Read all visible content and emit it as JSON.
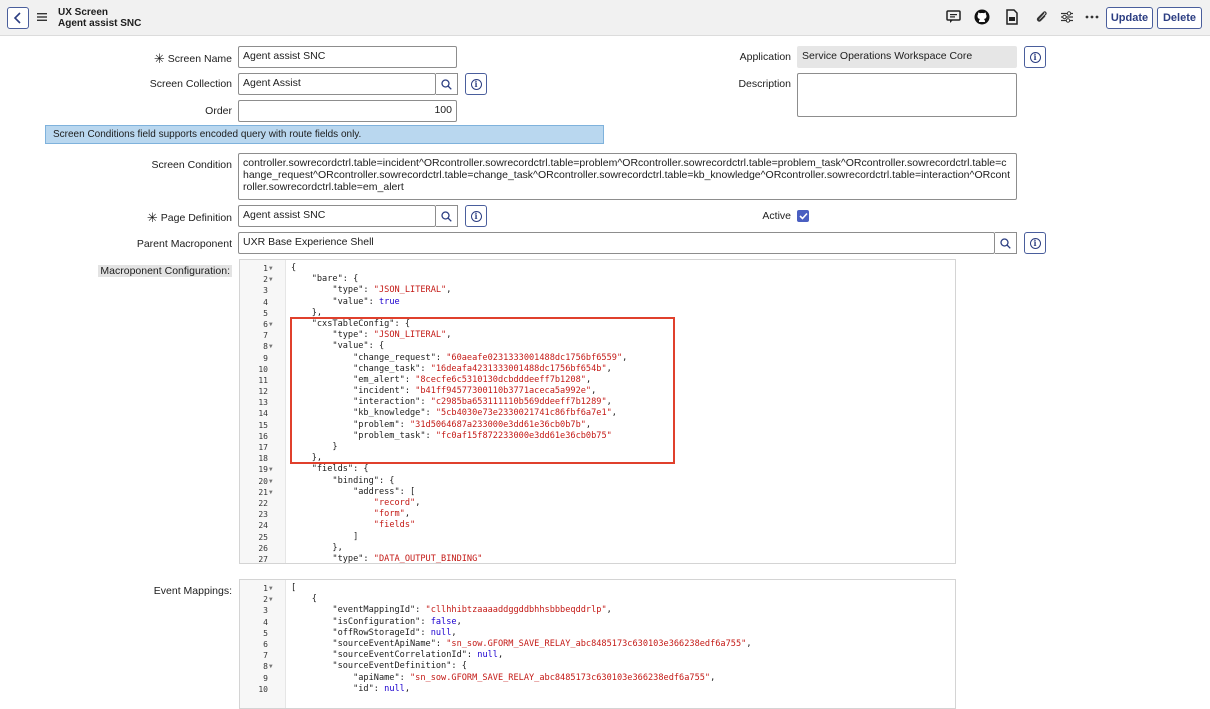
{
  "header": {
    "line1": "UX Screen",
    "line2": "Agent assist SNC",
    "icons": [
      "comment-icon",
      "github-icon",
      "document-icon",
      "attachment-icon",
      "settings-sliders-icon",
      "more-icon"
    ],
    "update_label": "Update",
    "delete_label": "Delete"
  },
  "form": {
    "screen_name_label": "Screen Name",
    "screen_name_value": "Agent assist SNC",
    "screen_collection_label": "Screen Collection",
    "screen_collection_value": "Agent Assist",
    "order_label": "Order",
    "order_value": "100",
    "application_label": "Application",
    "application_value": "Service Operations Workspace Core",
    "description_label": "Description",
    "description_value": "",
    "notice": "Screen Conditions field supports encoded query with route fields only.",
    "screen_condition_label": "Screen Condition",
    "screen_condition_value": "controller.sowrecordctrl.table=incident^ORcontroller.sowrecordctrl.table=problem^ORcontroller.sowrecordctrl.table=problem_task^ORcontroller.sowrecordctrl.table=change_request^ORcontroller.sowrecordctrl.table=change_task^ORcontroller.sowrecordctrl.table=kb_knowledge^ORcontroller.sowrecordctrl.table=interaction^ORcontroller.sowrecordctrl.table=em_alert",
    "page_definition_label": "Page Definition",
    "page_definition_value": "Agent assist SNC",
    "active_label": "Active",
    "active_checked": true,
    "parent_macroponent_label": "Parent Macroponent",
    "parent_macroponent_value": "UXR Base Experience Shell",
    "macroponent_config_label": "Macroponent Configuration:",
    "event_mappings_label": "Event Mappings:"
  },
  "macroponent_config": [
    {
      "n": "1",
      "f": true,
      "t": "{"
    },
    {
      "n": "2",
      "f": true,
      "t": "    \"bare\": {"
    },
    {
      "n": "3",
      "f": false,
      "t": "        \"type\": ",
      "s": "\"JSON_LITERAL\"",
      "e": ","
    },
    {
      "n": "4",
      "f": false,
      "t": "        \"value\": ",
      "k": "true"
    },
    {
      "n": "5",
      "f": false,
      "t": "    },"
    },
    {
      "n": "6",
      "f": true,
      "t": "    \"cxsTableConfig\": {"
    },
    {
      "n": "7",
      "f": false,
      "t": "        \"type\": ",
      "s": "\"JSON_LITERAL\"",
      "e": ","
    },
    {
      "n": "8",
      "f": true,
      "t": "        \"value\": {"
    },
    {
      "n": "9",
      "f": false,
      "t": "            \"change_request\": ",
      "s": "\"60aeafe0231333001488dc1756bf6559\"",
      "e": ","
    },
    {
      "n": "10",
      "f": false,
      "t": "            \"change_task\": ",
      "s": "\"16deafa4231333001488dc1756bf654b\"",
      "e": ","
    },
    {
      "n": "11",
      "f": false,
      "t": "            \"em_alert\": ",
      "s": "\"8cecfe6c5310130dcbdddeeff7b1208\"",
      "e": ","
    },
    {
      "n": "12",
      "f": false,
      "t": "            \"incident\": ",
      "s": "\"b41ff94577300110b3771aceca5a992e\"",
      "e": ","
    },
    {
      "n": "13",
      "f": false,
      "t": "            \"interaction\": ",
      "s": "\"c2985ba653111110b569ddeeff7b1289\"",
      "e": ","
    },
    {
      "n": "14",
      "f": false,
      "t": "            \"kb_knowledge\": ",
      "s": "\"5cb4030e73e2330021741c86fbf6a7e1\"",
      "e": ","
    },
    {
      "n": "15",
      "f": false,
      "t": "            \"problem\": ",
      "s": "\"31d5064687a233000e3dd61e36cb0b7b\"",
      "e": ","
    },
    {
      "n": "16",
      "f": false,
      "t": "            \"problem_task\": ",
      "s": "\"fc0af15f872233000e3dd61e36cb0b75\""
    },
    {
      "n": "17",
      "f": false,
      "t": "        }"
    },
    {
      "n": "18",
      "f": false,
      "t": "    },"
    },
    {
      "n": "19",
      "f": true,
      "t": "    \"fields\": {"
    },
    {
      "n": "20",
      "f": true,
      "t": "        \"binding\": {"
    },
    {
      "n": "21",
      "f": true,
      "t": "            \"address\": ["
    },
    {
      "n": "22",
      "f": false,
      "t": "                ",
      "s": "\"record\"",
      "e": ","
    },
    {
      "n": "23",
      "f": false,
      "t": "                ",
      "s": "\"form\"",
      "e": ","
    },
    {
      "n": "24",
      "f": false,
      "t": "                ",
      "s": "\"fields\""
    },
    {
      "n": "25",
      "f": false,
      "t": "            ]"
    },
    {
      "n": "26",
      "f": false,
      "t": "        },"
    },
    {
      "n": "27",
      "f": false,
      "t": "        \"type\": ",
      "s": "\"DATA_OUTPUT_BINDING\""
    }
  ],
  "event_mappings": [
    {
      "n": "1",
      "f": true,
      "t": "["
    },
    {
      "n": "2",
      "f": true,
      "t": "    {"
    },
    {
      "n": "3",
      "f": false,
      "t": "        \"eventMappingId\": ",
      "s": "\"cllhhibtzaaaaddggddbhhsbbbeqddrlp\"",
      "e": ","
    },
    {
      "n": "4",
      "f": false,
      "t": "        \"isConfiguration\": ",
      "k": "false",
      "e": ","
    },
    {
      "n": "5",
      "f": false,
      "t": "        \"offRowStorageId\": ",
      "k": "null",
      "e": ","
    },
    {
      "n": "6",
      "f": false,
      "t": "        \"sourceEventApiName\": ",
      "s": "\"sn_sow.GFORM_SAVE_RELAY_abc8485173c630103e366238edf6a755\"",
      "e": ","
    },
    {
      "n": "7",
      "f": false,
      "t": "        \"sourceEventCorrelationId\": ",
      "k": "null",
      "e": ","
    },
    {
      "n": "8",
      "f": true,
      "t": "        \"sourceEventDefinition\": {"
    },
    {
      "n": "9",
      "f": false,
      "t": "            \"apiName\": ",
      "s": "\"sn_sow.GFORM_SAVE_RELAY_abc8485173c630103e366238edf6a755\"",
      "e": ","
    },
    {
      "n": "10",
      "f": false,
      "t": "            \"id\": ",
      "k": "null",
      "e": ","
    }
  ]
}
